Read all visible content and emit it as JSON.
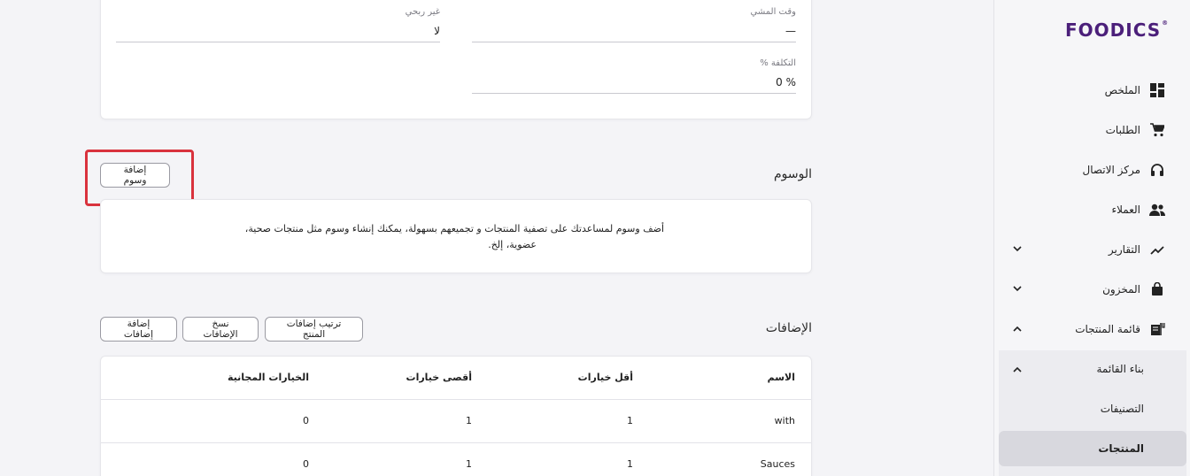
{
  "brand": {
    "logo_text": "FOODICS",
    "logo_mark": "®",
    "color": "#4b1f7a"
  },
  "sidebar": {
    "items": [
      {
        "label": "الملخص",
        "icon": "dashboard-icon"
      },
      {
        "label": "الطلبات",
        "icon": "cart-icon"
      },
      {
        "label": "مركز الاتصال",
        "icon": "headset-icon"
      },
      {
        "label": "العملاء",
        "icon": "people-icon"
      },
      {
        "label": "التقارير",
        "icon": "chart-line-icon",
        "expandable": true,
        "expanded": false
      },
      {
        "label": "المخزون",
        "icon": "bag-icon",
        "expandable": true,
        "expanded": false
      },
      {
        "label": "قائمة المنتجات",
        "icon": "menu-icon",
        "expandable": true,
        "expanded": true
      }
    ],
    "submenu": {
      "group_label": "بناء القائمة",
      "items": [
        {
          "label": "التصنيفات",
          "active": false
        },
        {
          "label": "المنتجات",
          "active": true
        }
      ]
    }
  },
  "details": {
    "fields": [
      {
        "label": "وقت المشي",
        "value": "—"
      },
      {
        "label": "غير ربحي",
        "value": "لا"
      },
      {
        "label": "التكلفة %",
        "value": "0 %"
      }
    ]
  },
  "tags": {
    "title": "الوسوم",
    "add_button": "إضافة وسوم",
    "empty_text_line1": "أضف وسوم لمساعدتك على تصفية المنتجات و تجميعهم بسهولة، يمكنك إنشاء وسوم مثل منتجات صحية،",
    "empty_text_line2": "عضوية، إلخ."
  },
  "modifiers": {
    "title": "الإضافات",
    "buttons": {
      "sort": "ترتيب إضافات المنتج",
      "copy": "نسخ الإضافات",
      "add": "إضافة إضافات"
    },
    "columns": [
      "الاسم",
      "أقل خيارات",
      "أقصى خيارات",
      "الخيارات المجانية"
    ],
    "rows": [
      [
        "with",
        "1",
        "1",
        "0"
      ],
      [
        "Sauces",
        "1",
        "1",
        "0"
      ]
    ]
  },
  "highlight_color": "#d9323d"
}
